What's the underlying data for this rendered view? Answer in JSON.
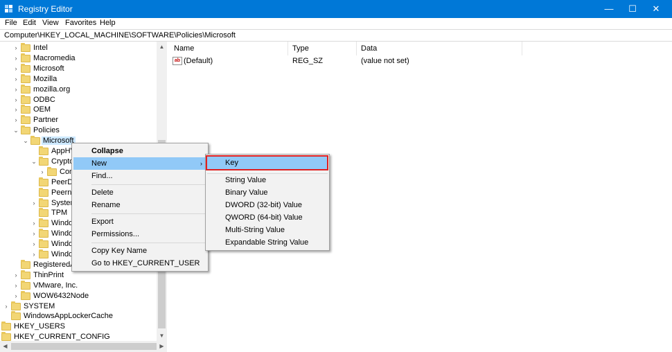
{
  "window": {
    "title": "Registry Editor",
    "minimize": "—",
    "maximize": "☐",
    "close": "✕"
  },
  "menubar": [
    "File",
    "Edit",
    "View",
    "Favorites",
    "Help"
  ],
  "address": "Computer\\HKEY_LOCAL_MACHINE\\SOFTWARE\\Policies\\Microsoft",
  "tree": [
    {
      "label": "Intel",
      "arrow": "›",
      "indent": 0
    },
    {
      "label": "Macromedia",
      "arrow": "›",
      "indent": 0
    },
    {
      "label": "Microsoft",
      "arrow": "›",
      "indent": 0
    },
    {
      "label": "Mozilla",
      "arrow": "›",
      "indent": 0
    },
    {
      "label": "mozilla.org",
      "arrow": "›",
      "indent": 0
    },
    {
      "label": "ODBC",
      "arrow": "›",
      "indent": 0
    },
    {
      "label": "OEM",
      "arrow": "›",
      "indent": 0
    },
    {
      "label": "Partner",
      "arrow": "›",
      "indent": 0
    },
    {
      "label": "Policies",
      "arrow": "⌄",
      "indent": 0
    },
    {
      "label": "Microsoft",
      "arrow": "⌄",
      "indent": 1,
      "selected": true
    },
    {
      "label": "AppHV",
      "arrow": "",
      "indent": 2
    },
    {
      "label": "Crypto",
      "arrow": "⌄",
      "indent": 2
    },
    {
      "label": "Con",
      "arrow": "›",
      "indent": 3
    },
    {
      "label": "PeerDis",
      "arrow": "",
      "indent": 2
    },
    {
      "label": "Peerne",
      "arrow": "",
      "indent": 2
    },
    {
      "label": "System",
      "arrow": "›",
      "indent": 2
    },
    {
      "label": "TPM",
      "arrow": "",
      "indent": 2
    },
    {
      "label": "Windo",
      "arrow": "›",
      "indent": 2
    },
    {
      "label": "Windo",
      "arrow": "›",
      "indent": 2
    },
    {
      "label": "Windo",
      "arrow": "›",
      "indent": 2
    },
    {
      "label": "Windo",
      "arrow": "›",
      "indent": 2
    },
    {
      "label": "RegisteredAp",
      "arrow": "",
      "indent": 0
    },
    {
      "label": "ThinPrint",
      "arrow": "›",
      "indent": 0
    },
    {
      "label": "VMware, Inc.",
      "arrow": "›",
      "indent": 0
    },
    {
      "label": "WOW6432Node",
      "arrow": "›",
      "indent": 0
    },
    {
      "label": "SYSTEM",
      "arrow": "›",
      "indent": -1
    },
    {
      "label": "WindowsAppLockerCache",
      "arrow": "",
      "indent": -1
    },
    {
      "label": "HKEY_USERS",
      "arrow": "",
      "indent": -2
    },
    {
      "label": "HKEY_CURRENT_CONFIG",
      "arrow": "",
      "indent": -2
    }
  ],
  "columns": {
    "name": "Name",
    "type": "Type",
    "data": "Data"
  },
  "values": [
    {
      "name": "(Default)",
      "type": "REG_SZ",
      "data": "(value not set)",
      "icon": "ab"
    }
  ],
  "context_menu": {
    "collapse": "Collapse",
    "new": "New",
    "find": "Find...",
    "delete": "Delete",
    "rename": "Rename",
    "export": "Export",
    "permissions": "Permissions...",
    "copy_key_name": "Copy Key Name",
    "goto_hkcu": "Go to HKEY_CURRENT_USER",
    "submenu_arrow": "›"
  },
  "new_submenu": {
    "key": "Key",
    "string_value": "String Value",
    "binary_value": "Binary Value",
    "dword": "DWORD (32-bit) Value",
    "qword": "QWORD (64-bit) Value",
    "multi_string": "Multi-String Value",
    "expandable_string": "Expandable String Value"
  },
  "colors": {
    "titlebar": "#0078d7",
    "highlight": "#91c9f7",
    "key_outline": "#e02020",
    "folder": "#f2d675"
  }
}
